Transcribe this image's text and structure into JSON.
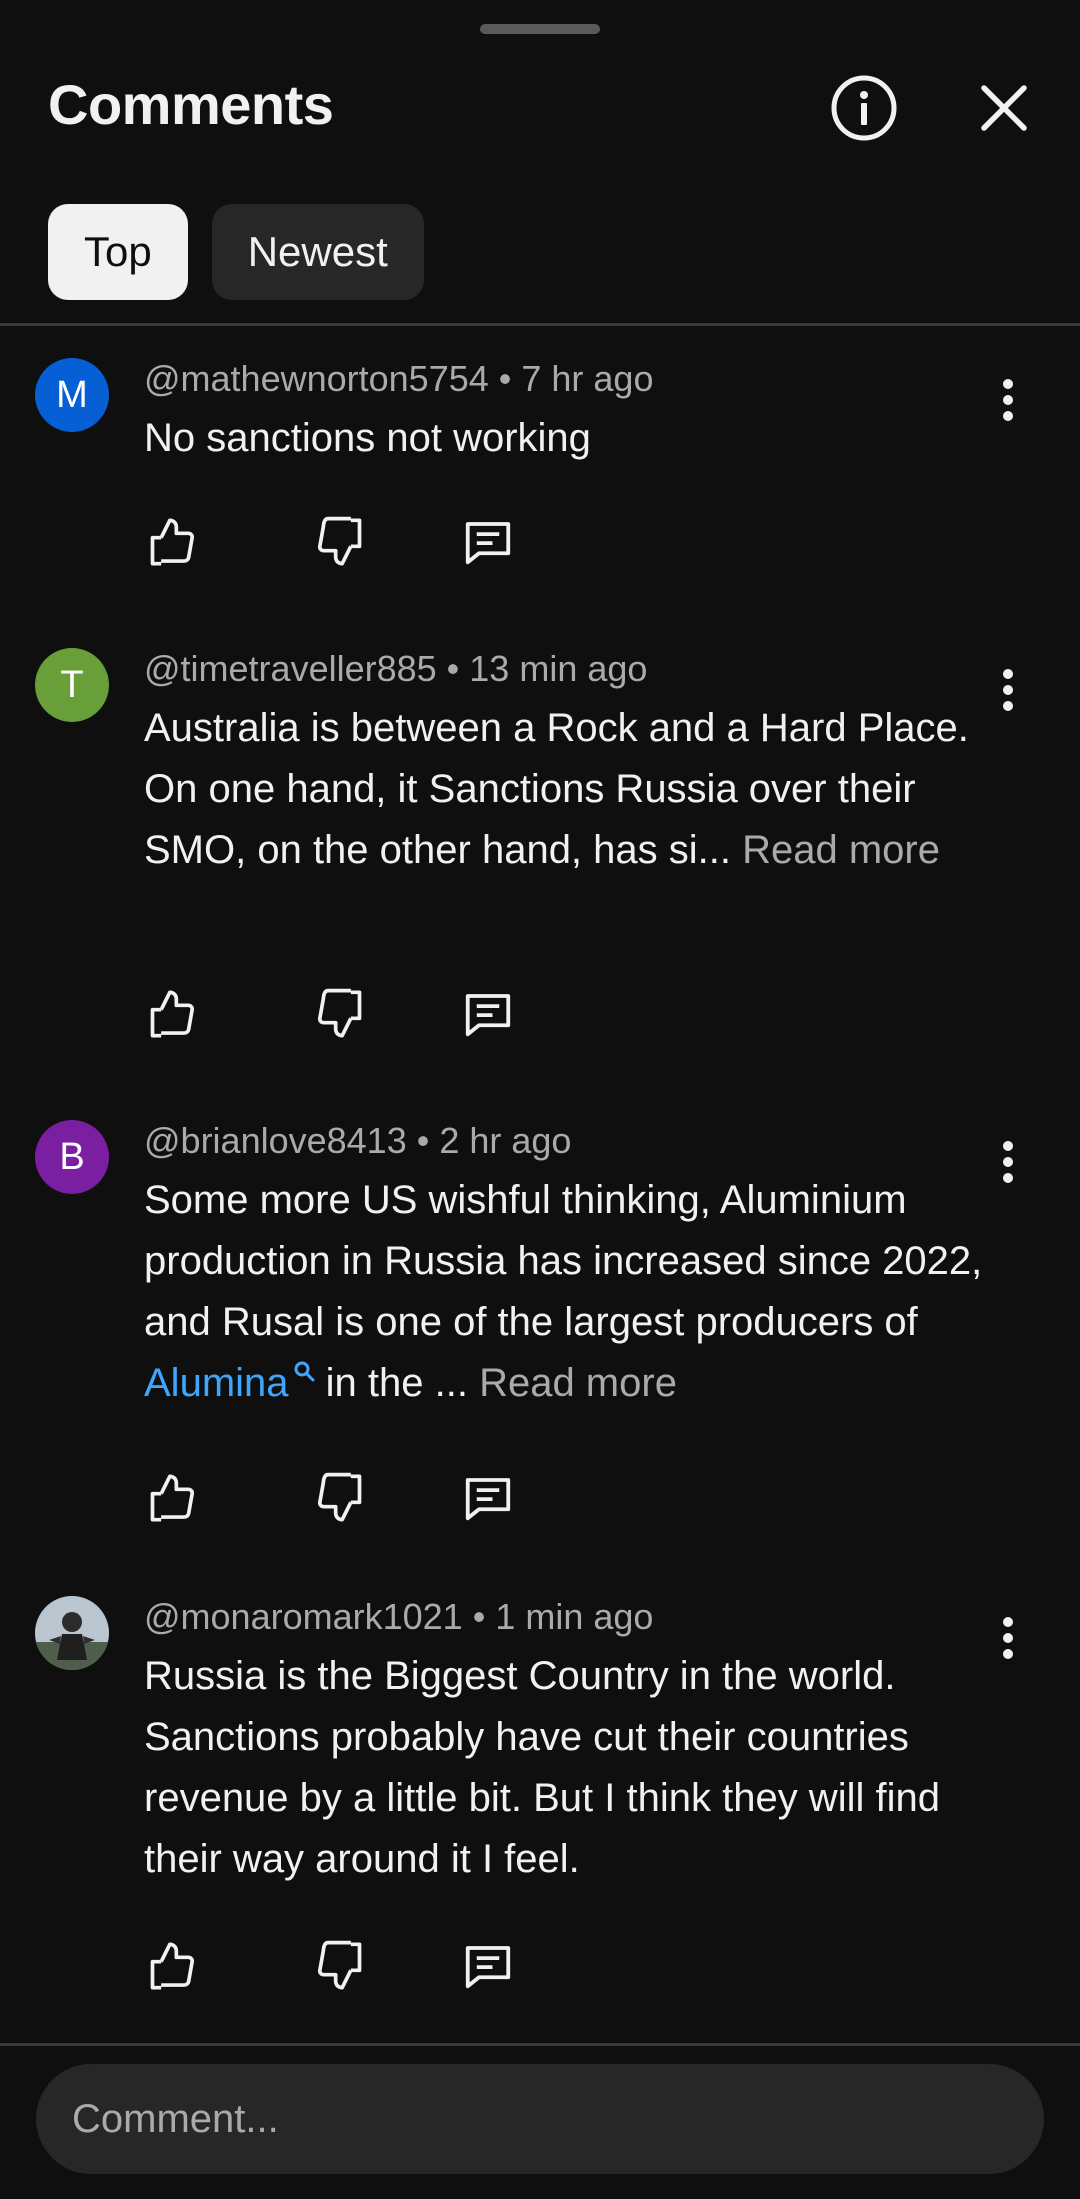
{
  "header": {
    "title": "Comments",
    "info_icon": "info-icon",
    "close_icon": "close-icon"
  },
  "tabs": [
    {
      "label": "Top",
      "selected": true
    },
    {
      "label": "Newest",
      "selected": false
    }
  ],
  "comments": [
    {
      "avatar_letter": "M",
      "avatar_color": "#065fd4",
      "author": "@mathewnorton5754",
      "time": "7 hr ago",
      "text": "No sanctions not working"
    },
    {
      "avatar_letter": "T",
      "avatar_color": "#689f38",
      "author": "@timetraveller885",
      "time": "13 min ago",
      "text_line1": "Australia is between a Rock and a Hard Place.",
      "text_line2": "On one hand, it Sanctions Russia over their SMO, on the other hand, has si...",
      "read_more": "Read more"
    },
    {
      "avatar_letter": "B",
      "avatar_color": "#7b1fa2",
      "author": "@brianlove8413",
      "time": "2 hr ago",
      "text_before_link": "Some more US wishful thinking, Aluminium production in Russia has increased since 2022, and Rusal is one of the largest producers of ",
      "link_text": "Alumina",
      "text_after_link": " in the ...",
      "read_more": "Read more"
    },
    {
      "avatar_icon": "profile-photo",
      "author": "@monaromark1021",
      "time": "1 min ago",
      "text": "Russia is the Biggest Country in the world. Sanctions probably have cut their countries revenue by a little bit. But I think they will find their way around it I feel."
    }
  ],
  "meta_separator": " • ",
  "colors": {
    "background": "#0f0f0f",
    "link": "#3ea6ff",
    "secondary_text": "#aaaaaa"
  },
  "input": {
    "placeholder": "Comment..."
  }
}
